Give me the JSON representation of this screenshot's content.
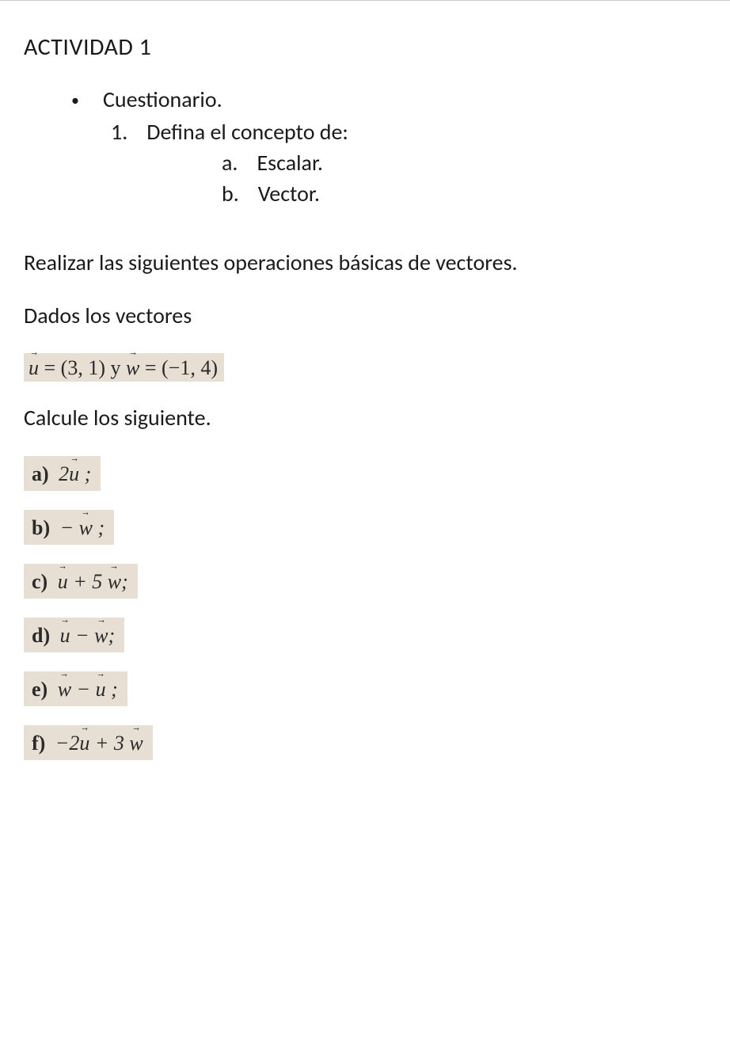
{
  "document": {
    "title": "ACTIVIDAD 1",
    "bullet": {
      "marker": "•",
      "label": "Cuestionario."
    },
    "question1": {
      "marker": "1.",
      "text": "Defina el concepto de:",
      "sub_a": {
        "marker": "a.",
        "text": "Escalar."
      },
      "sub_b": {
        "marker": "b.",
        "text": "Vector."
      }
    },
    "instruction1": "Realizar las siguientes operaciones básicas de vectores.",
    "instruction2": "Dados los vectores",
    "vectors_def": {
      "u_label": "u",
      "u_value": " = (3, 1) y  ",
      "w_label": "w",
      "w_value": " = (−1, 4)"
    },
    "calculate": "Calcule los siguiente.",
    "items": {
      "a": {
        "label": "a)",
        "prefix": "2",
        "v1": "u",
        "suffix": " ;"
      },
      "b": {
        "label": "b)",
        "prefix": "− ",
        "v1": "w",
        "suffix": " ;"
      },
      "c": {
        "label": "c)",
        "v1": "u",
        "mid": " + 5 ",
        "v2": "w",
        "suffix": ";"
      },
      "d": {
        "label": "d)",
        "v1": "u",
        "mid": " − ",
        "v2": "w",
        "suffix": ";"
      },
      "e": {
        "label": "e)",
        "v1": "w",
        "mid": " − ",
        "v2": "u",
        "suffix": " ;"
      },
      "f": {
        "label": "f)",
        "prefix": "−2",
        "v1": "u",
        "mid": "  + 3 ",
        "v2": "w",
        "suffix": ""
      }
    }
  }
}
